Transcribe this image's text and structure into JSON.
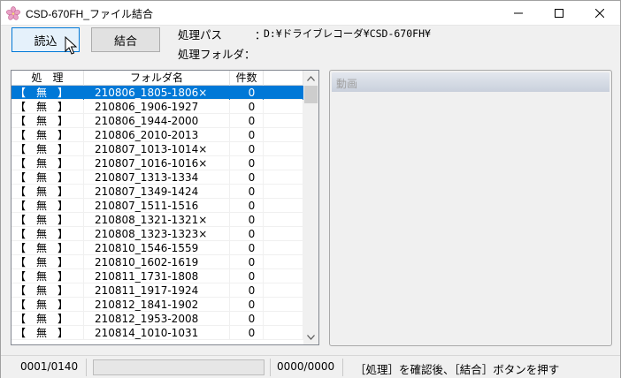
{
  "window": {
    "title": "CSD-670FH_ファイル結合",
    "minimize_glyph": "─",
    "maximize_glyph": "☐",
    "close_glyph": "✕"
  },
  "toolbar": {
    "read_label": "読込",
    "merge_label": "結合"
  },
  "info": {
    "path_label": "処理パス",
    "path_colon": "：",
    "path_value": "D:¥ドライブレコーダ¥CSD-670FH¥",
    "folder_label": "処理フォルダ："
  },
  "list": {
    "headers": [
      "処　理",
      "フォルダ名",
      "件数",
      ""
    ],
    "rows": [
      {
        "status": "【　無　】",
        "folder": "210806_1805-1806×",
        "count": "0"
      },
      {
        "status": "【　無　】",
        "folder": "210806_1906-1927",
        "count": "0"
      },
      {
        "status": "【　無　】",
        "folder": "210806_1944-2000",
        "count": "0"
      },
      {
        "status": "【　無　】",
        "folder": "210806_2010-2013",
        "count": "0"
      },
      {
        "status": "【　無　】",
        "folder": "210807_1013-1014×",
        "count": "0"
      },
      {
        "status": "【　無　】",
        "folder": "210807_1016-1016×",
        "count": "0"
      },
      {
        "status": "【　無　】",
        "folder": "210807_1313-1334",
        "count": "0"
      },
      {
        "status": "【　無　】",
        "folder": "210807_1349-1424",
        "count": "0"
      },
      {
        "status": "【　無　】",
        "folder": "210807_1511-1516",
        "count": "0"
      },
      {
        "status": "【　無　】",
        "folder": "210808_1321-1321×",
        "count": "0"
      },
      {
        "status": "【　無　】",
        "folder": "210808_1323-1323×",
        "count": "0"
      },
      {
        "status": "【　無　】",
        "folder": "210810_1546-1559",
        "count": "0"
      },
      {
        "status": "【　無　】",
        "folder": "210810_1602-1619",
        "count": "0"
      },
      {
        "status": "【　無　】",
        "folder": "210811_1731-1808",
        "count": "0"
      },
      {
        "status": "【　無　】",
        "folder": "210811_1917-1924",
        "count": "0"
      },
      {
        "status": "【　無　】",
        "folder": "210812_1841-1902",
        "count": "0"
      },
      {
        "status": "【　無　】",
        "folder": "210812_1953-2008",
        "count": "0"
      },
      {
        "status": "【　無　】",
        "folder": "210814_1010-1031",
        "count": "0"
      }
    ],
    "selected_index": 0
  },
  "video": {
    "title": "動画"
  },
  "status": {
    "file_count": "0001/0140",
    "progress": 0,
    "frame_count": "0000/0000",
    "message": "［処理］を確認後、［結合］ボタンを押す"
  },
  "colors": {
    "selection": "#0078d7",
    "progress": "#06b025"
  },
  "icons": {
    "app": "sakura-flower-icon",
    "scroll_up": "chevron-up-icon",
    "scroll_down": "chevron-down-icon"
  }
}
